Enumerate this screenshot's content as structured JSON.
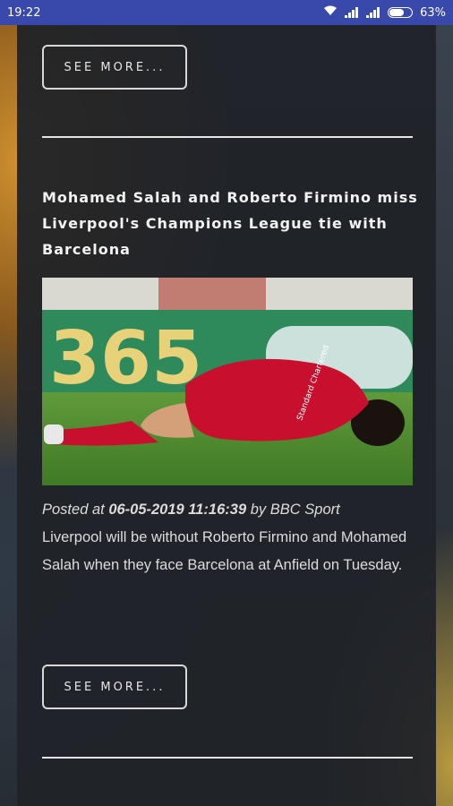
{
  "status_bar": {
    "time": "19:22",
    "battery": "63%"
  },
  "top_button": {
    "label": "SEE MORE..."
  },
  "article": {
    "title": "Mohamed Salah and Roberto Firmino miss Liverpool's Champions League tie with Barcelona",
    "posted_prefix": "Posted at",
    "posted_date": "06-05-2019 11:16:39",
    "posted_by_prefix": "by",
    "source": "BBC Sport",
    "summary": "Liverpool will be without Roberto Firmino and Mohamed Salah when they face Barcelona at Anfield on Tuesday.",
    "image_text": "365",
    "image_brand": "Standard Chartered"
  },
  "bottom_button": {
    "label": "SEE MORE..."
  },
  "colors": {
    "status_bar": "#3949ab",
    "panel": "#202328",
    "kit_red": "#c8102e",
    "pitch": "#4a8a2e"
  }
}
